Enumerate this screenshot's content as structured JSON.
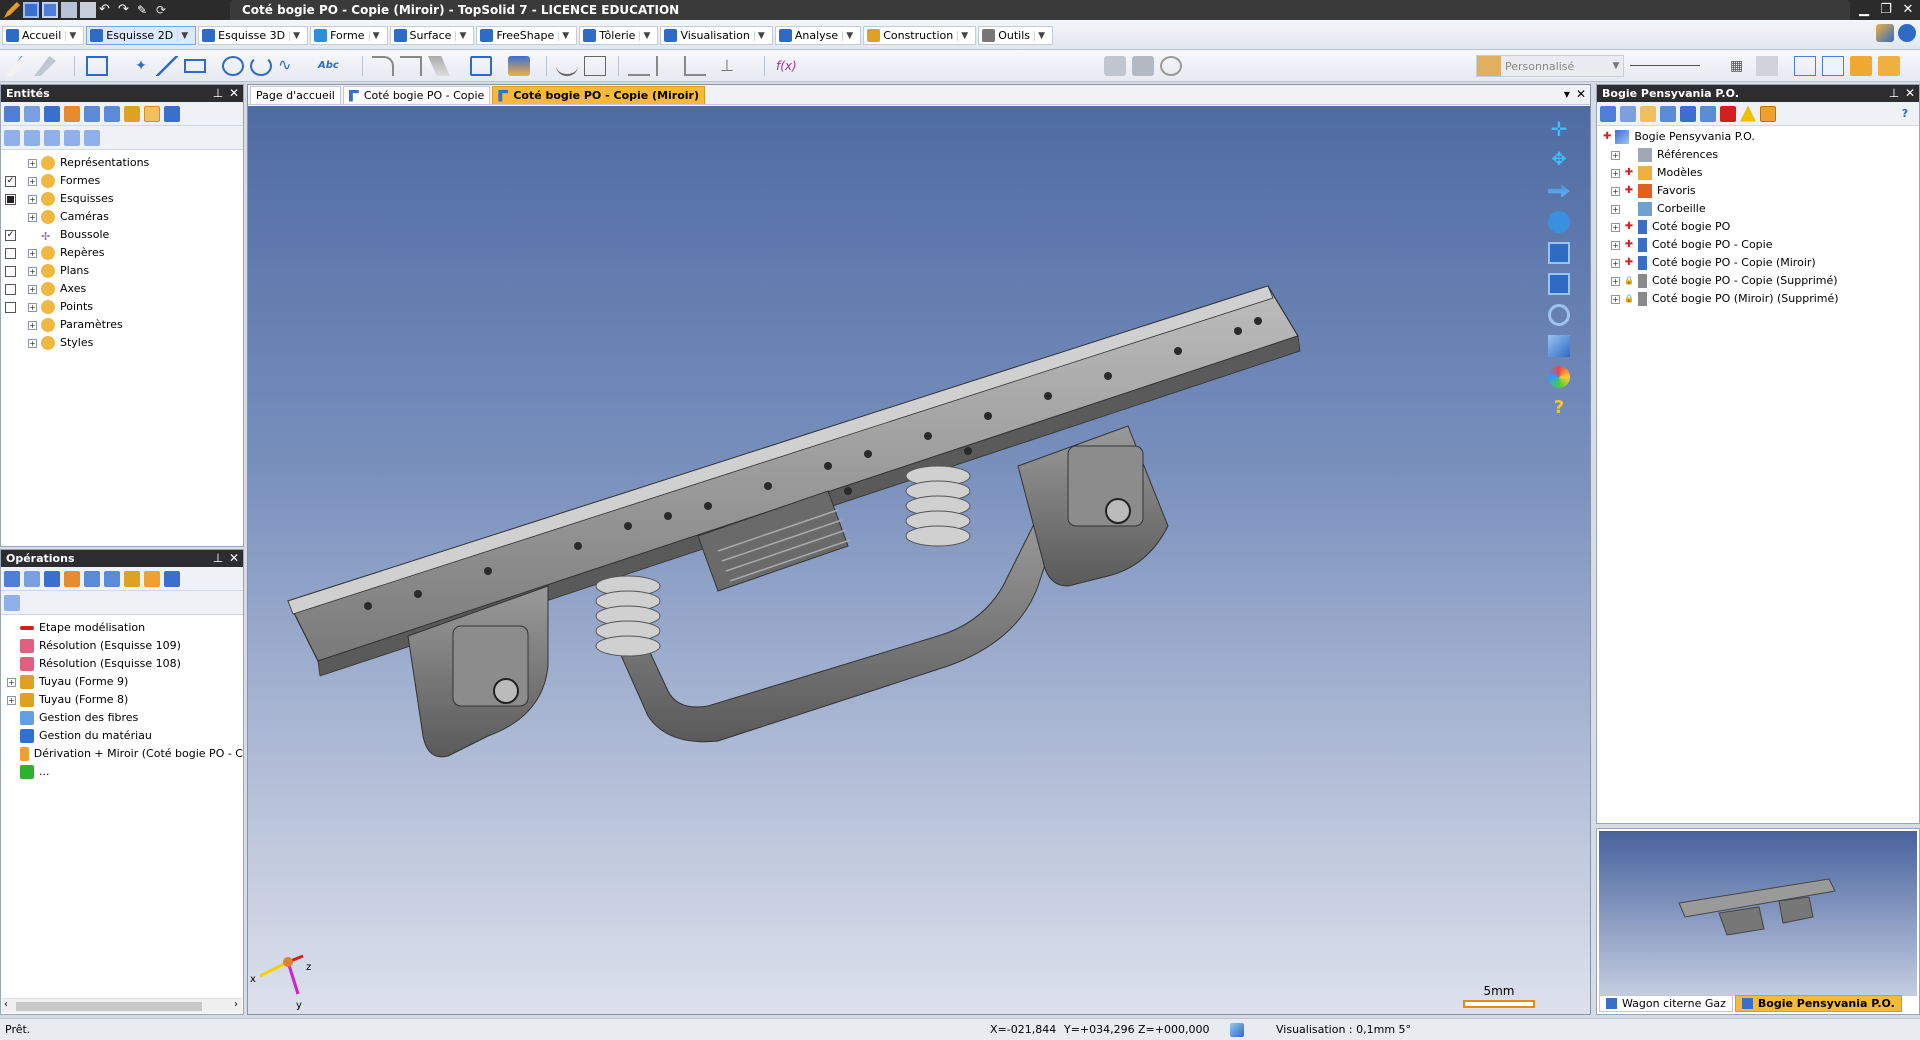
{
  "window": {
    "title": "Coté bogie PO - Copie (Miroir) - TopSolid 7 - LICENCE EDUCATION"
  },
  "ribbon": {
    "tabs": [
      {
        "label": "Accueil",
        "color": "#2f6bc5"
      },
      {
        "label": "Esquisse 2D",
        "color": "#2f6bc5"
      },
      {
        "label": "Esquisse 3D",
        "color": "#2f6bc5"
      },
      {
        "label": "Forme",
        "color": "#2f8fd6"
      },
      {
        "label": "Surface",
        "color": "#2f6bc5"
      },
      {
        "label": "FreeShape",
        "color": "#2f6bc5"
      },
      {
        "label": "Tôlerie",
        "color": "#2f6bc5"
      },
      {
        "label": "Visualisation",
        "color": "#2f6bc5"
      },
      {
        "label": "Analyse",
        "color": "#2f6bc5"
      },
      {
        "label": "Construction",
        "color": "#e0a020"
      },
      {
        "label": "Outils",
        "color": "#777777"
      }
    ],
    "active_tab": "Esquisse 2D"
  },
  "toolbar": {
    "style_select": "Personnalisé"
  },
  "entities_panel": {
    "title": "Entités",
    "items": [
      {
        "label": "Représentations",
        "check": "none"
      },
      {
        "label": "Formes",
        "check": "checked"
      },
      {
        "label": "Esquisses",
        "check": "filled"
      },
      {
        "label": "Caméras",
        "check": "none"
      },
      {
        "label": "Boussole",
        "check": "checked"
      },
      {
        "label": "Repères",
        "check": "empty"
      },
      {
        "label": "Plans",
        "check": "empty"
      },
      {
        "label": "Axes",
        "check": "empty"
      },
      {
        "label": "Points",
        "check": "empty"
      },
      {
        "label": "Paramètres",
        "check": "none"
      },
      {
        "label": "Styles",
        "check": "none"
      }
    ]
  },
  "operations_panel": {
    "title": "Opérations",
    "items": [
      {
        "label": "Etape modélisation",
        "icon": "arrow-icon",
        "expandable": false
      },
      {
        "label": "Résolution (Esquisse 109)",
        "icon": "sketch-icon",
        "expandable": false
      },
      {
        "label": "Résolution (Esquisse 108)",
        "icon": "sketch-icon",
        "expandable": false
      },
      {
        "label": "Tuyau (Forme 9)",
        "icon": "pipe-icon",
        "expandable": true
      },
      {
        "label": "Tuyau (Forme 8)",
        "icon": "pipe-icon",
        "expandable": true
      },
      {
        "label": "Gestion des fibres",
        "icon": "fibers-icon",
        "expandable": false
      },
      {
        "label": "Gestion du matériau",
        "icon": "material-icon",
        "expandable": false
      },
      {
        "label": "Dérivation + Miroir (Coté bogie PO - C",
        "icon": "mirror-icon",
        "expandable": false
      },
      {
        "label": "...",
        "icon": "step-icon",
        "expandable": false
      }
    ]
  },
  "doc_tabs": [
    {
      "label": "Page d'accueil",
      "active": false,
      "icon": false
    },
    {
      "label": "Coté bogie PO - Copie",
      "active": false,
      "icon": true
    },
    {
      "label": "Coté bogie PO - Copie (Miroir)",
      "active": true,
      "icon": true
    }
  ],
  "scale_bar": {
    "label": "5mm"
  },
  "triad": {
    "x": "x",
    "y": "y",
    "z": "z"
  },
  "project_panel": {
    "title": "Bogie Pensyvania P.O.",
    "root": "Bogie Pensyvania P.O.",
    "items": [
      {
        "label": "Références",
        "icon": "references-icon"
      },
      {
        "label": "Modèles",
        "icon": "models-icon"
      },
      {
        "label": "Favoris",
        "icon": "favorites-icon"
      },
      {
        "label": "Corbeille",
        "icon": "trash-icon"
      },
      {
        "label": "Coté bogie PO",
        "icon": "part-icon"
      },
      {
        "label": "Coté bogie PO - Copie",
        "icon": "part-icon"
      },
      {
        "label": "Coté bogie PO - Copie (Miroir)",
        "icon": "part-icon"
      },
      {
        "label": "Coté bogie PO - Copie (Supprimé)",
        "icon": "locked-part-icon"
      },
      {
        "label": "Coté bogie PO (Miroir) (Supprimé)",
        "icon": "locked-part-icon"
      }
    ]
  },
  "preview_tabs": [
    {
      "label": "Wagon citerne Gaz",
      "active": false
    },
    {
      "label": "Bogie Pensyvania P.O.",
      "active": true
    }
  ],
  "status": {
    "text": "Prêt.",
    "x": "X=-021,844",
    "y": "Y=+034,296",
    "z": "Z=+000,000",
    "visualisation": "Visualisation : 0,1mm 5°"
  }
}
